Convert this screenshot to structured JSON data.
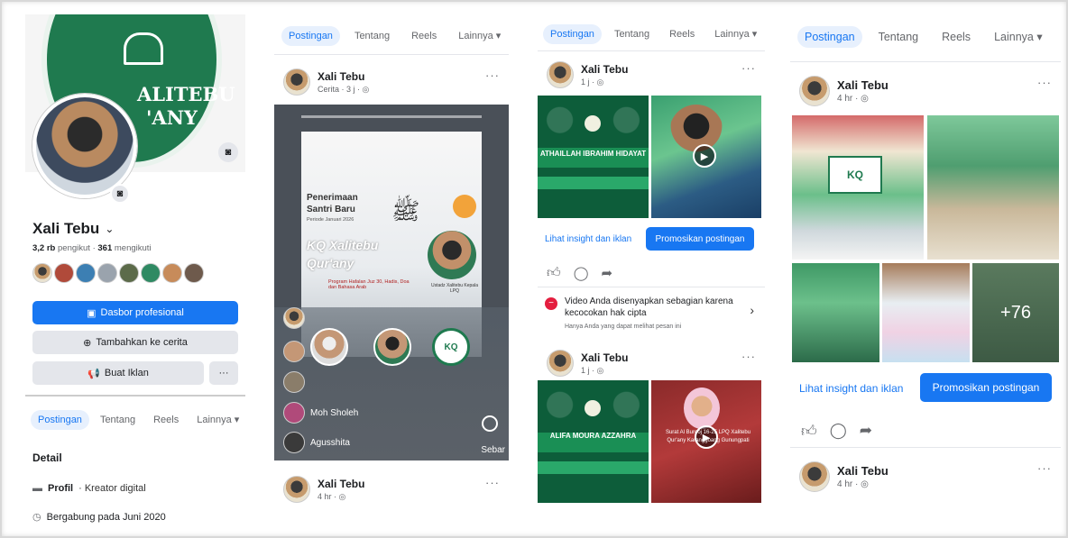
{
  "profile": {
    "cover_text_top": "ALITEBU",
    "cover_text_bottom": "'ANY",
    "name": "Xali Tebu",
    "followers_count": "3,2 rb",
    "followers_label": "pengikut",
    "following_count": "361",
    "following_label": "mengikuti",
    "dashboard_button": "Dasbor profesional",
    "add_story_button": "Tambahkan ke cerita",
    "ad_button": "Buat Iklan",
    "more_button": "···",
    "tabs": [
      "Postingan",
      "Tentang",
      "Reels",
      "Lainnya ▾"
    ],
    "detail_heading": "Detail",
    "detail_profile_label": "Profil",
    "detail_profile_value": "· Kreator digital",
    "joined": "Bergabung pada Juni 2020"
  },
  "feed_tabs": [
    "Postingan",
    "Tentang",
    "Reels",
    "Lainnya ▾"
  ],
  "panel2": {
    "author": "Xali Tebu",
    "meta": "Cerita · 3 j · ◎",
    "story_title_line1": "Penerimaan",
    "story_title_line2": "Santri Baru",
    "story_period": "Periode Januari 2026",
    "story_brand_line1": "KQ Xalitebu",
    "story_brand_line2": "Qur'any",
    "story_program": "Program Hafalan Juz 30, Hadis, Doa dan Bahasa Arab",
    "story_person1": "Ustadz Xalitebu Kepala LPQ",
    "viewers": [
      "Moh Sholeh",
      "Agusshita"
    ],
    "see_more": "Sebar",
    "footer_author": "Xali Tebu",
    "footer_meta": "4 hr · ◎"
  },
  "panel3": {
    "post1_author": "Xali Tebu",
    "post1_meta": "1 j · ◎",
    "post1_tile_title": "ATHAILLAH IBRAHIM HIDAYAT",
    "insight_link": "Lihat insight dan iklan",
    "promote_button": "Promosikan postingan",
    "notice_title": "Video Anda disenyapkan sebagian karena kecocokan hak cipta",
    "notice_sub": "Hanya Anda yang dapat melihat pesan ini",
    "post2_author": "Xali Tebu",
    "post2_meta": "1 j · ◎",
    "post2_tile_title": "ALIFA MOURA AZZAHRA",
    "post2_caption": "Surat Al Burooj 16-25 LPQ Xalitebu Qur'any Karanggoang Gunungpati"
  },
  "panel4": {
    "author": "Xali Tebu",
    "meta": "4 hr · ◎",
    "more_photos": "+76",
    "insight_link": "Lihat insight dan iklan",
    "promote_button": "Promosikan postingan",
    "footer_author": "Xali Tebu",
    "footer_meta": "4 hr · ◎"
  },
  "colors": {
    "brand_blue": "#1877f2",
    "brand_green": "#0d5d3a",
    "soft_blue": "#e7f0fd",
    "grey_button": "#e4e6eb"
  }
}
